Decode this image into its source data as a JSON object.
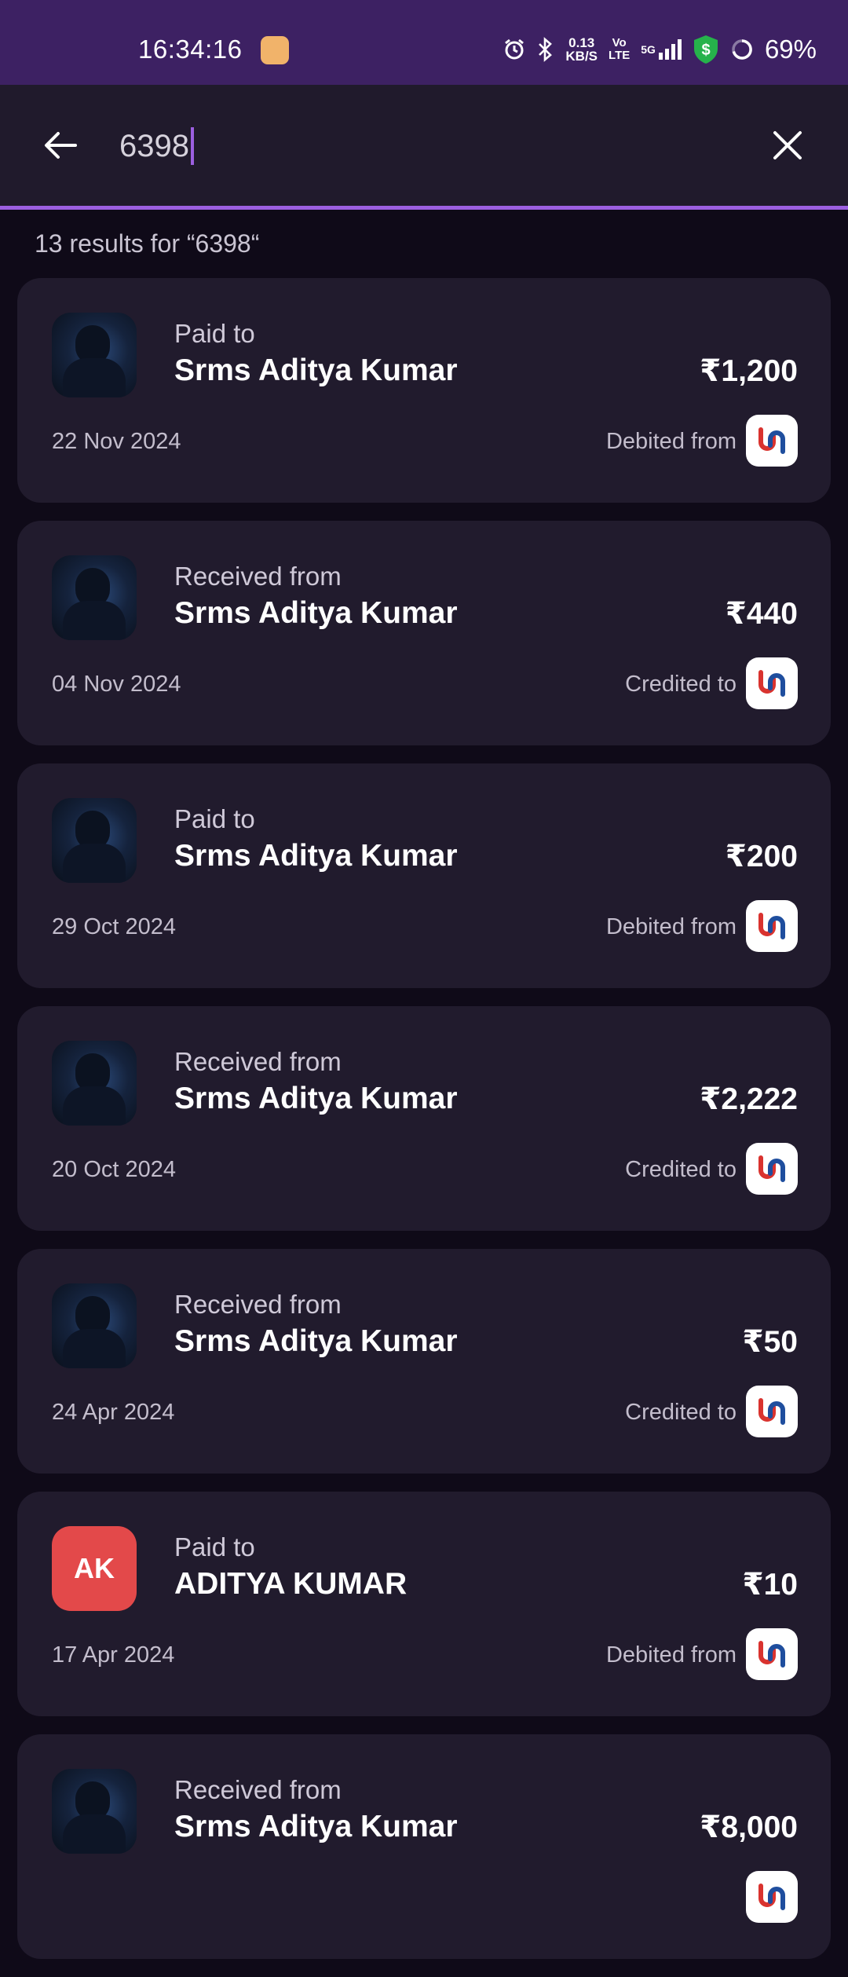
{
  "status_bar": {
    "time": "16:34:16",
    "speed_value": "0.13",
    "speed_unit": "KB/S",
    "volte_top": "Vo",
    "volte_bottom": "LTE",
    "network": "5G",
    "battery": "69%"
  },
  "search": {
    "query": "6398",
    "results_text": "13 results for “6398“"
  },
  "transactions": [
    {
      "type": "Paid to",
      "name": "Srms Aditya Kumar",
      "amount": "₹1,200",
      "date": "22 Nov 2024",
      "account_label": "Debited from",
      "avatar": "photo"
    },
    {
      "type": "Received from",
      "name": "Srms Aditya Kumar",
      "amount": "₹440",
      "date": "04 Nov 2024",
      "account_label": "Credited to",
      "avatar": "photo"
    },
    {
      "type": "Paid to",
      "name": "Srms Aditya Kumar",
      "amount": "₹200",
      "date": "29 Oct 2024",
      "account_label": "Debited from",
      "avatar": "photo"
    },
    {
      "type": "Received from",
      "name": "Srms Aditya Kumar",
      "amount": "₹2,222",
      "date": "20 Oct 2024",
      "account_label": "Credited to",
      "avatar": "photo"
    },
    {
      "type": "Received from",
      "name": "Srms Aditya Kumar",
      "amount": "₹50",
      "date": "24 Apr 2024",
      "account_label": "Credited to",
      "avatar": "photo"
    },
    {
      "type": "Paid to",
      "name": "ADITYA KUMAR",
      "amount": "₹10",
      "date": "17 Apr 2024",
      "account_label": "Debited from",
      "avatar": "initials",
      "initials": "AK"
    },
    {
      "type": "Received from",
      "name": "Srms Aditya Kumar",
      "amount": "₹8,000",
      "date": "",
      "account_label": "",
      "avatar": "photo"
    }
  ],
  "colors": {
    "status_bar_bg": "#3d2163",
    "accent": "#9c5fe0",
    "card_bg": "#211b2d",
    "page_bg": "#0f0a18",
    "initials_avatar_bg": "#e3494a"
  },
  "icons": [
    "back-arrow-icon",
    "close-icon",
    "bank-logo-icon",
    "alarm-icon",
    "bluetooth-icon",
    "signal-icon",
    "shield-dollar-icon",
    "battery-ring-icon"
  ]
}
